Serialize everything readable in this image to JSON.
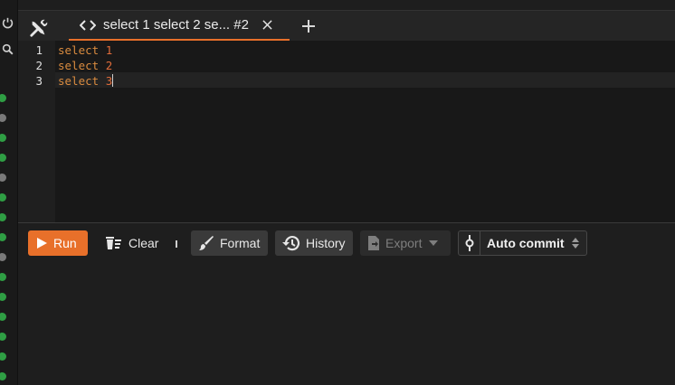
{
  "tab": {
    "title": "select 1 select 2 se... #2"
  },
  "editor": {
    "lines": [
      {
        "number": "1",
        "keyword": "select",
        "value": "1"
      },
      {
        "number": "2",
        "keyword": "select",
        "value": "2"
      },
      {
        "number": "3",
        "keyword": "select",
        "value": "3"
      }
    ]
  },
  "toolbar": {
    "run_label": "Run",
    "clear_label": "Clear",
    "format_label": "Format",
    "history_label": "History",
    "export_label": "Export",
    "autocommit_label": "Auto commit"
  },
  "colors": {
    "accent": "#e8702a",
    "keyword": "#d98b3f",
    "status_green": "#2f9e44"
  },
  "icons": [
    "power-icon",
    "search-icon",
    "tools-icon",
    "code-icon",
    "close-icon",
    "plus-icon",
    "play-icon",
    "clear-icon",
    "brush-icon",
    "history-icon",
    "file-export-icon",
    "caret-down-icon",
    "commit-icon",
    "sort-icon"
  ]
}
